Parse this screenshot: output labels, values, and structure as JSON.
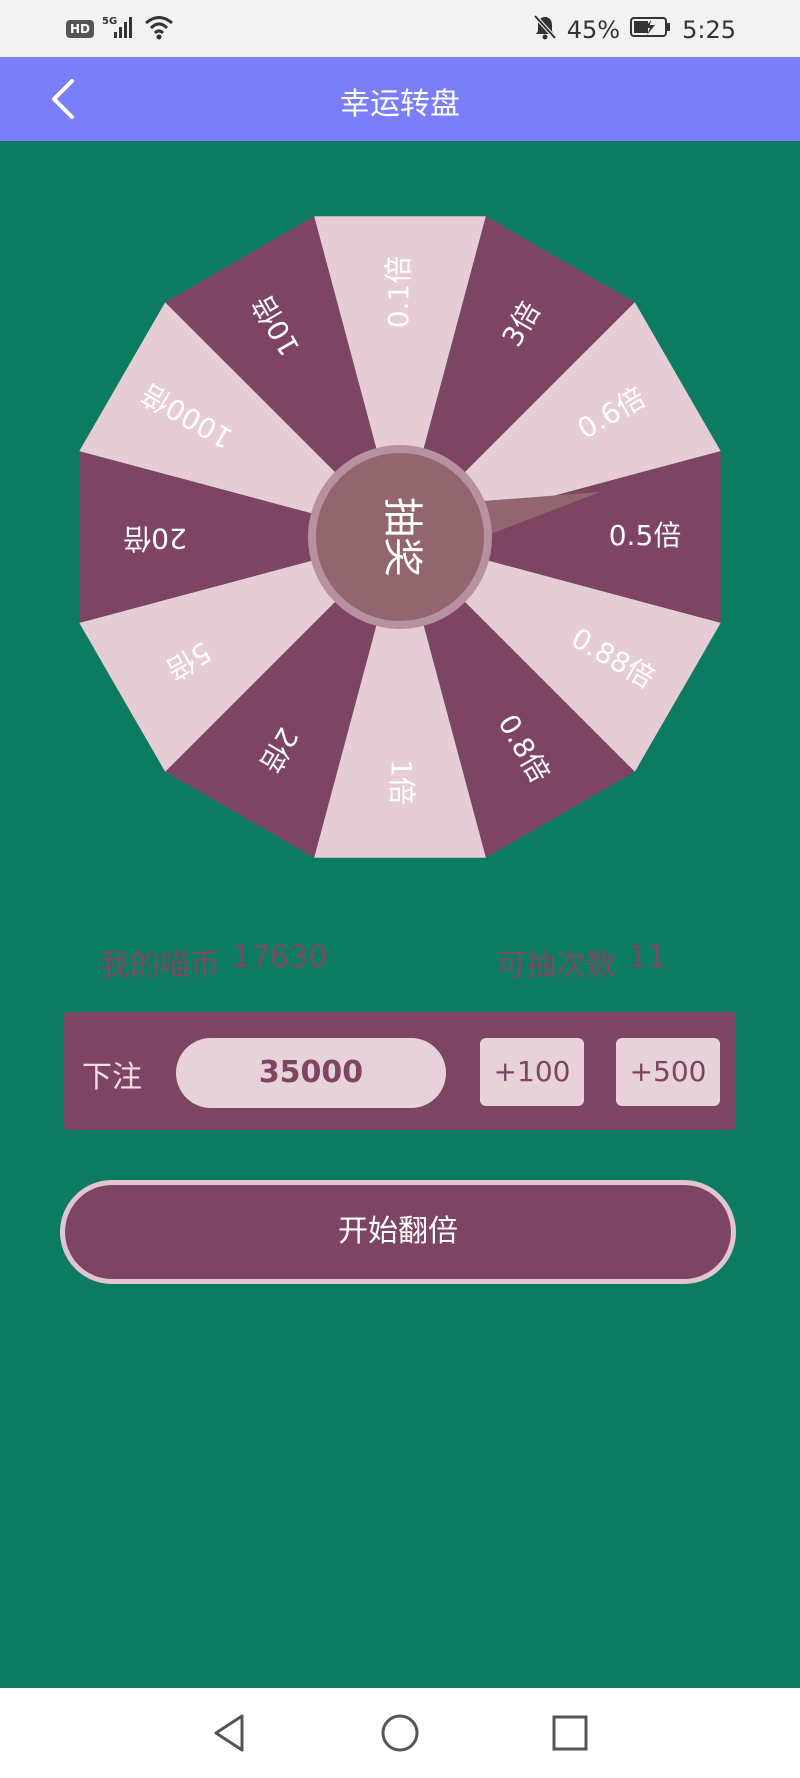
{
  "status_bar": {
    "badge": "HD",
    "network": "5G",
    "battery_percent": "45%",
    "time": "5:25",
    "icons": [
      "hd-icon",
      "signal-icon",
      "wifi-icon",
      "bell-muted-icon",
      "battery-icon"
    ]
  },
  "header": {
    "title": "幸运转盘",
    "back_icon": "chevron-left-icon"
  },
  "wheel": {
    "center_label": "抽奖",
    "segments": [
      "0.1倍",
      "3倍",
      "0.6倍",
      "0.5倍",
      "0.88倍",
      "0.8倍",
      "1倍",
      "2倍",
      "5倍",
      "20倍",
      "1000倍",
      "10倍"
    ],
    "colors": {
      "light": "#e6cdd5",
      "dark": "#7d4563",
      "hub": "#93666f",
      "hub_ring": "#b791a0"
    }
  },
  "stats": {
    "coins_label": "我的喵币",
    "coins_value": "17630",
    "draws_label": "可抽次数",
    "draws_value": "11"
  },
  "bet": {
    "label": "下注",
    "amount": "35000",
    "add_100": "+100",
    "add_500": "+500"
  },
  "start_button": {
    "label": "开始翻倍"
  },
  "nav": {
    "icons": [
      "back-triangle-icon",
      "home-circle-icon",
      "recents-square-icon"
    ]
  },
  "colors": {
    "background": "#0b7b62",
    "app_bar": "#7b7ef9",
    "accent": "#7d4563"
  }
}
